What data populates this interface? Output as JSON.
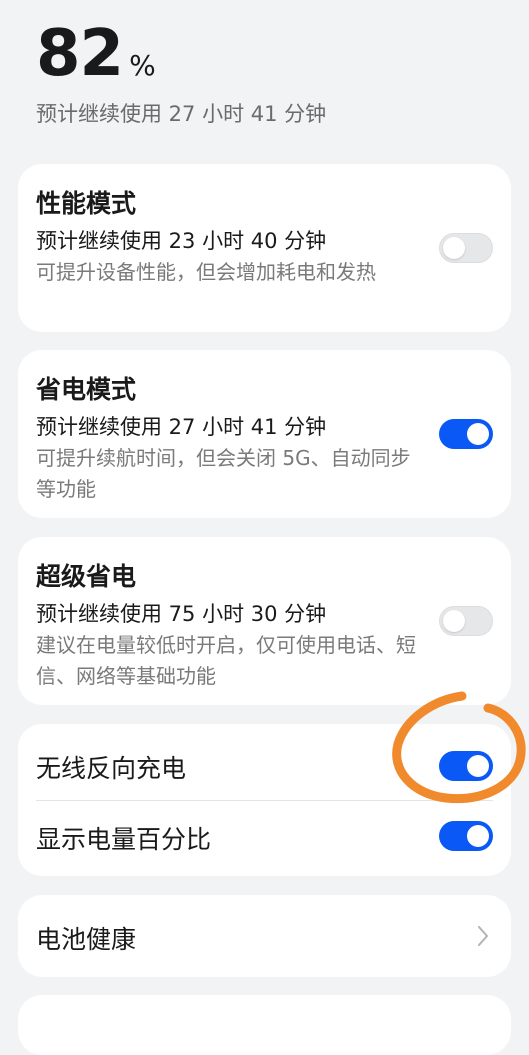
{
  "battery": {
    "level": "82",
    "unit": "%",
    "estimate": "预计继续使用 27 小时 41 分钟"
  },
  "modes": [
    {
      "title": "性能模式",
      "estimate": "预计继续使用 23 小时 40 分钟",
      "description": "可提升设备性能，但会增加耗电和发热",
      "enabled": false
    },
    {
      "title": "省电模式",
      "estimate": "预计继续使用 27 小时 41 分钟",
      "description": "可提升续航时间，但会关闭 5G、自动同步等功能",
      "enabled": true
    },
    {
      "title": "超级省电",
      "estimate": "预计继续使用 75 小时 30 分钟",
      "description": "建议在电量较低时开启，仅可使用电话、短信、网络等基础功能",
      "enabled": false
    }
  ],
  "settings": [
    {
      "label": "无线反向充电",
      "enabled": true
    },
    {
      "label": "显示电量百分比",
      "enabled": true
    }
  ],
  "battery_health": {
    "label": "电池健康",
    "icon": "chevron-right-icon"
  },
  "colors": {
    "accent": "#0a59f7",
    "annotation": "#f08a2c",
    "background": "#f1f3f5",
    "card": "#ffffff"
  }
}
